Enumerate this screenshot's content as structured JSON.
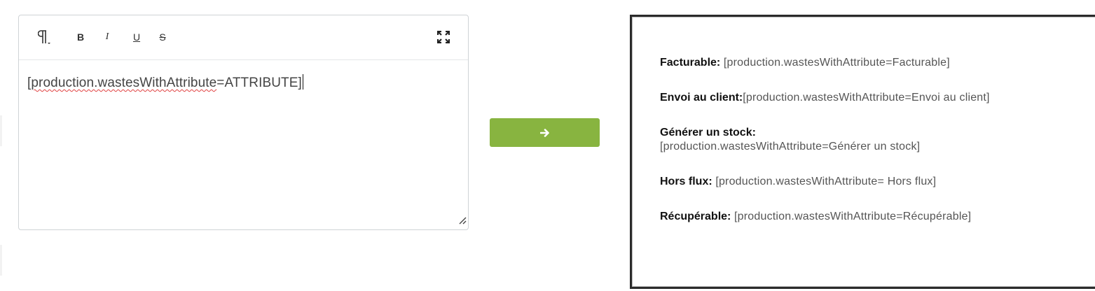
{
  "toolbar": {
    "paragraph": "paragraph-format",
    "bold": "B",
    "italic": "I",
    "underline": "U",
    "strike": "S",
    "fullscreen": "fullscreen"
  },
  "editor": {
    "content_squiggle": "production.wastesWithAttribute",
    "content_open": "[",
    "content_rest": "=ATTRIBUTE]"
  },
  "convert_button": {
    "icon": "arrow-right-icon",
    "color": "#88b440"
  },
  "preview": {
    "rows": [
      {
        "label": "Facturable:",
        "value": " [production.wastesWithAttribute=Facturable]"
      },
      {
        "label": "Envoi au client:",
        "value": "[production.wastesWithAttribute=Envoi au client]"
      },
      {
        "label": "Générer un stock:",
        "value": "[production.wastesWithAttribute=Générer un stock]"
      },
      {
        "label": "Hors flux:",
        "value": " [production.wastesWithAttribute= Hors flux]"
      },
      {
        "label": "Récupérable:",
        "value": " [production.wastesWithAttribute=Récupérable]"
      }
    ]
  }
}
